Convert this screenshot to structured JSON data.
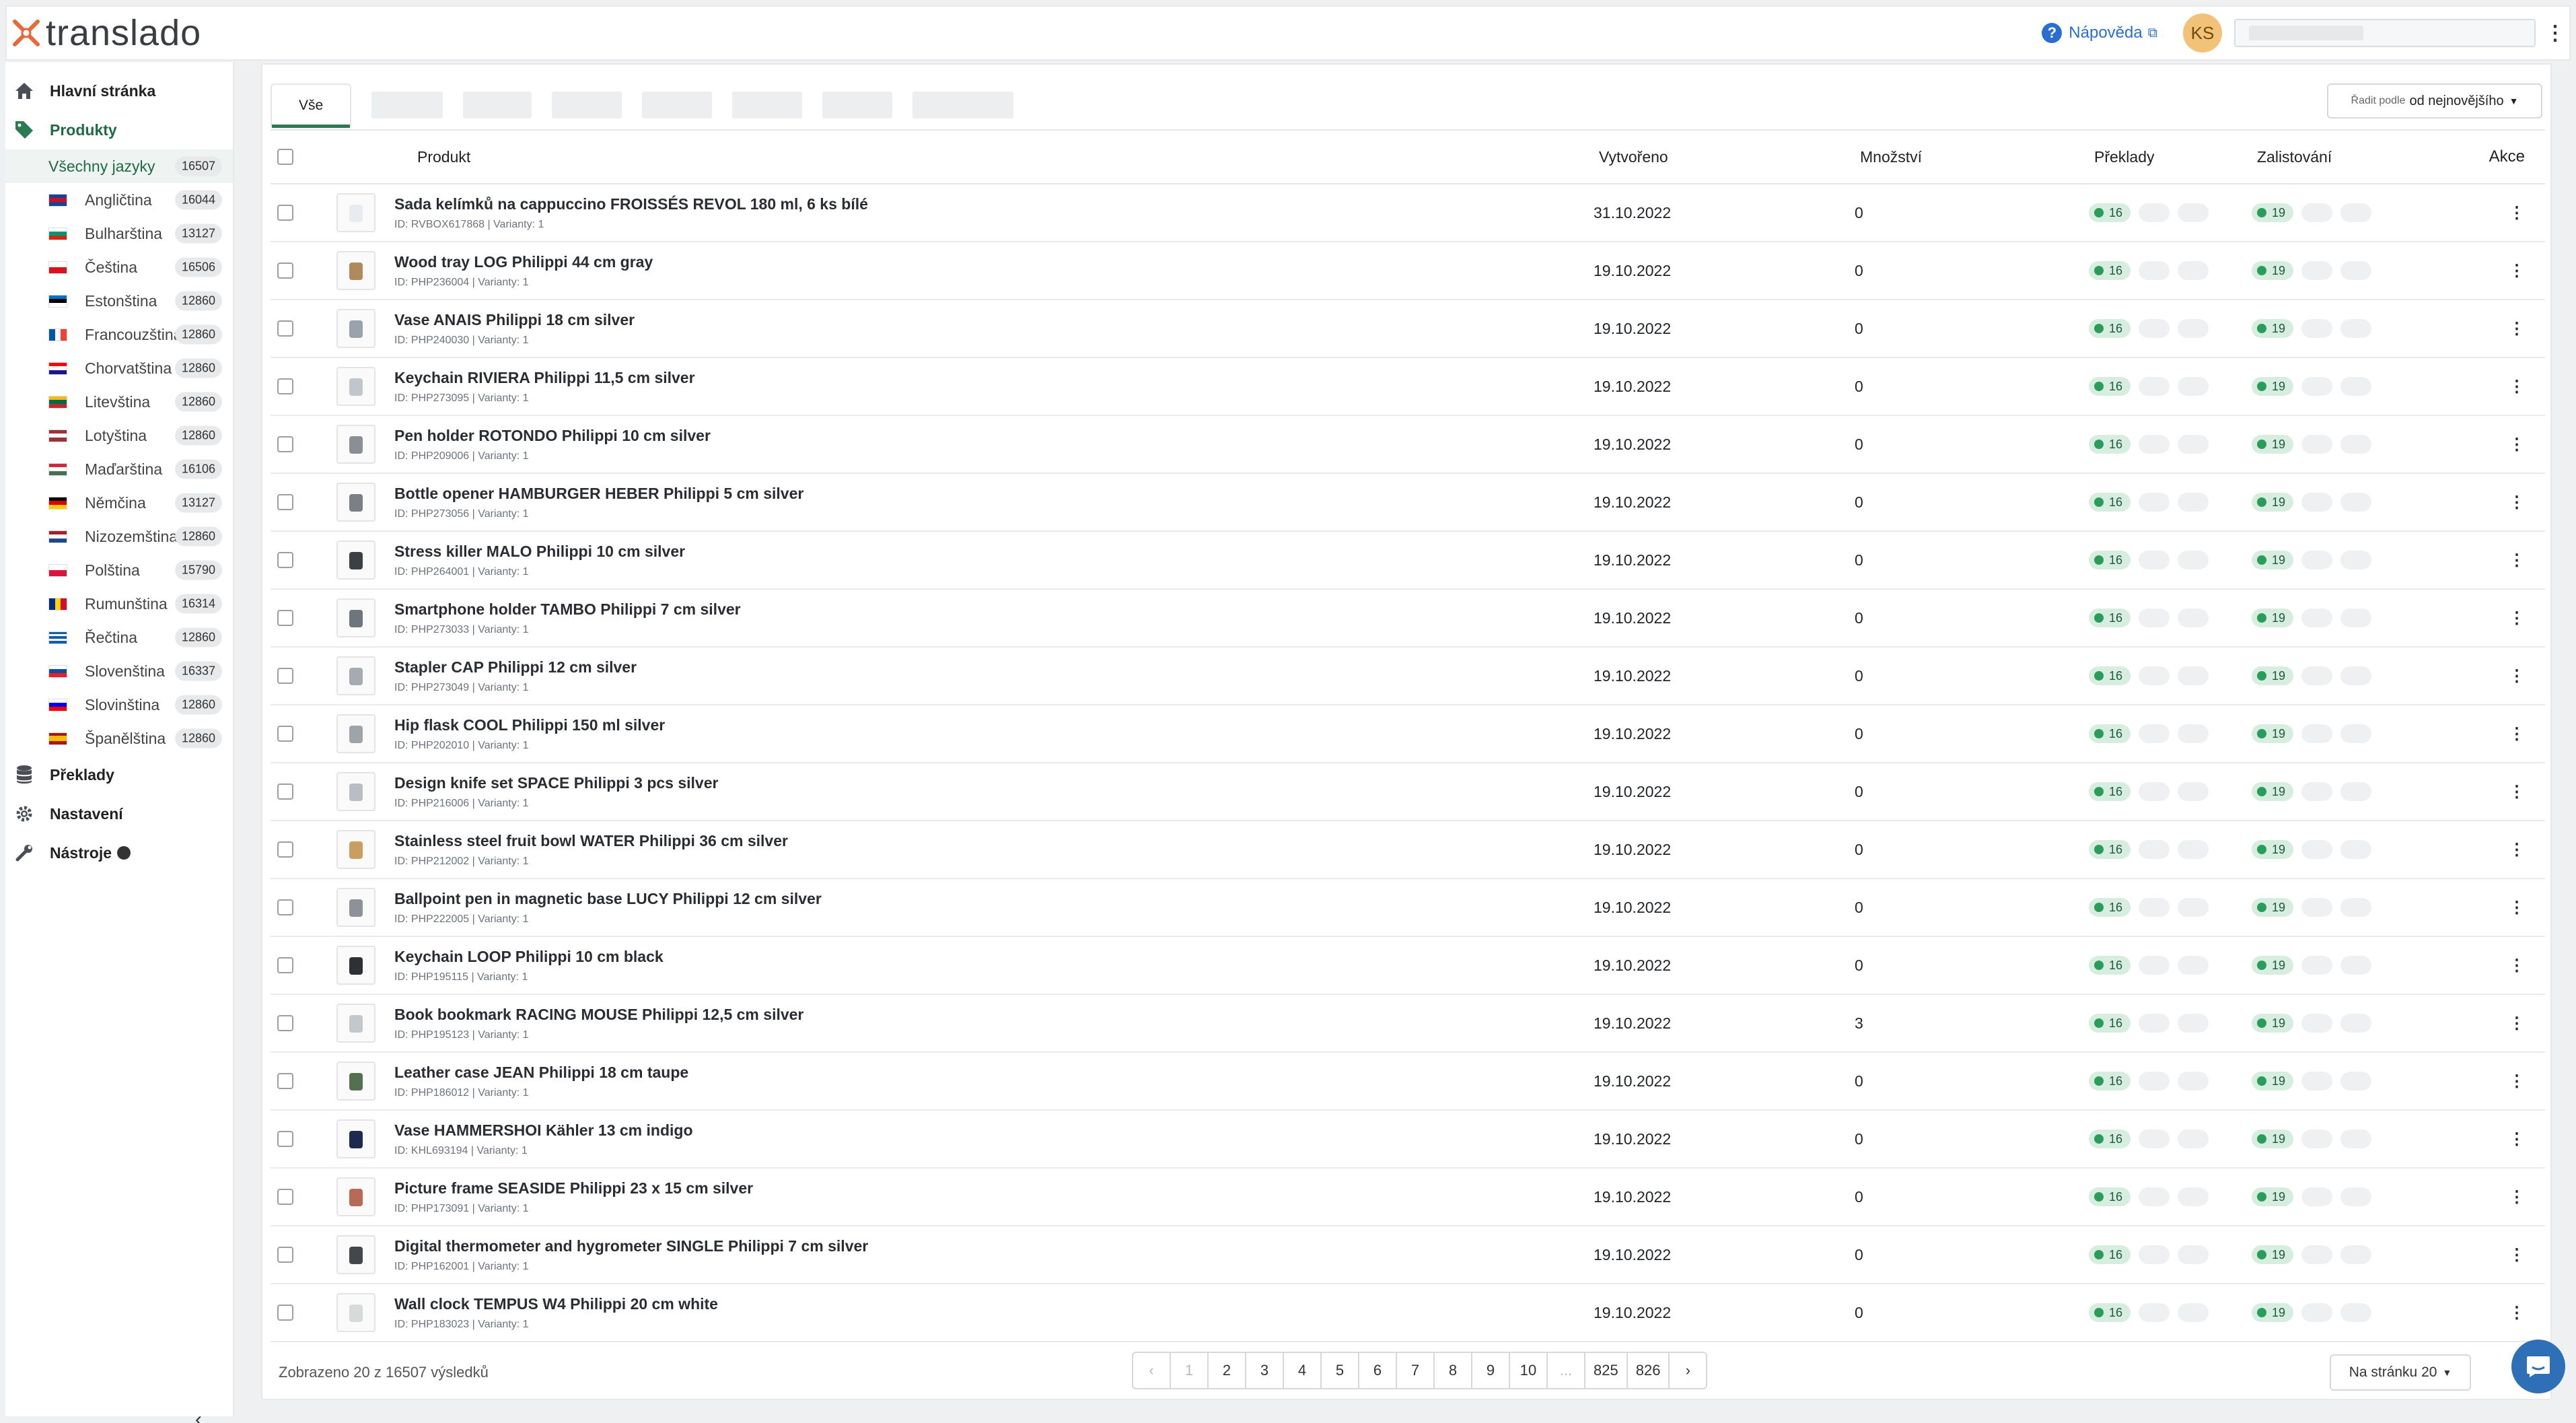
{
  "app": {
    "logo_text": "translado"
  },
  "header": {
    "help_label": "Nápověda",
    "avatar_initials": "KS"
  },
  "sidebar": {
    "home": "Hlavní stránka",
    "products": "Produkty",
    "all_languages": {
      "label": "Všechny jazyky",
      "count": "16507"
    },
    "languages": [
      {
        "label": "Angličtina",
        "count": "16044",
        "flag": "gb"
      },
      {
        "label": "Bulharština",
        "count": "13127",
        "flag": "bg"
      },
      {
        "label": "Čeština",
        "count": "16506",
        "flag": "cz"
      },
      {
        "label": "Estonština",
        "count": "12860",
        "flag": "ee"
      },
      {
        "label": "Francouzština",
        "count": "12860",
        "flag": "fr"
      },
      {
        "label": "Chorvatština",
        "count": "12860",
        "flag": "hr"
      },
      {
        "label": "Litevština",
        "count": "12860",
        "flag": "lt"
      },
      {
        "label": "Lotyština",
        "count": "12860",
        "flag": "lv"
      },
      {
        "label": "Maďarština",
        "count": "16106",
        "flag": "hu"
      },
      {
        "label": "Němčina",
        "count": "13127",
        "flag": "de"
      },
      {
        "label": "Nizozemština",
        "count": "12860",
        "flag": "nl"
      },
      {
        "label": "Polština",
        "count": "15790",
        "flag": "pl"
      },
      {
        "label": "Rumunština",
        "count": "16314",
        "flag": "ro"
      },
      {
        "label": "Řečtina",
        "count": "12860",
        "flag": "gr"
      },
      {
        "label": "Slovenština",
        "count": "16337",
        "flag": "sk"
      },
      {
        "label": "Slovinština",
        "count": "12860",
        "flag": "si"
      },
      {
        "label": "Španělština",
        "count": "12860",
        "flag": "es"
      }
    ],
    "translations": "Překlady",
    "settings": "Nastavení",
    "tools": "Nástroje"
  },
  "tabs": {
    "all": "Vše"
  },
  "sort": {
    "prefix": "Řadit podle",
    "value": "od nejnovějšího"
  },
  "table": {
    "headers": {
      "product": "Produkt",
      "created": "Vytvořeno",
      "quantity": "Množství",
      "translations": "Překlady",
      "listings": "Zalistování",
      "actions": "Akce"
    },
    "rows": [
      {
        "name": "Sada kelímků na cappuccino FROISSÉS REVOL 180 ml, 6 ks bílé",
        "meta": "ID: RVBOX617868 | Varianty: 1",
        "date": "31.10.2022",
        "qty": "0",
        "tr": "16",
        "ls": "19"
      },
      {
        "name": "Wood tray LOG Philippi 44 cm gray",
        "meta": "ID: PHP236004 | Varianty: 1",
        "date": "19.10.2022",
        "qty": "0",
        "tr": "16",
        "ls": "19"
      },
      {
        "name": "Vase ANAIS Philippi 18 cm silver",
        "meta": "ID: PHP240030 | Varianty: 1",
        "date": "19.10.2022",
        "qty": "0",
        "tr": "16",
        "ls": "19"
      },
      {
        "name": "Keychain RIVIERA Philippi 11,5 cm silver",
        "meta": "ID: PHP273095 | Varianty: 1",
        "date": "19.10.2022",
        "qty": "0",
        "tr": "16",
        "ls": "19"
      },
      {
        "name": "Pen holder ROTONDO Philippi 10 cm silver",
        "meta": "ID: PHP209006 | Varianty: 1",
        "date": "19.10.2022",
        "qty": "0",
        "tr": "16",
        "ls": "19"
      },
      {
        "name": "Bottle opener HAMBURGER HEBER Philippi 5 cm silver",
        "meta": "ID: PHP273056 | Varianty: 1",
        "date": "19.10.2022",
        "qty": "0",
        "tr": "16",
        "ls": "19"
      },
      {
        "name": "Stress killer MALO Philippi 10 cm silver",
        "meta": "ID: PHP264001 | Varianty: 1",
        "date": "19.10.2022",
        "qty": "0",
        "tr": "16",
        "ls": "19"
      },
      {
        "name": "Smartphone holder TAMBO Philippi 7 cm silver",
        "meta": "ID: PHP273033 | Varianty: 1",
        "date": "19.10.2022",
        "qty": "0",
        "tr": "16",
        "ls": "19"
      },
      {
        "name": "Stapler CAP Philippi 12 cm silver",
        "meta": "ID: PHP273049 | Varianty: 1",
        "date": "19.10.2022",
        "qty": "0",
        "tr": "16",
        "ls": "19"
      },
      {
        "name": "Hip flask COOL Philippi 150 ml silver",
        "meta": "ID: PHP202010 | Varianty: 1",
        "date": "19.10.2022",
        "qty": "0",
        "tr": "16",
        "ls": "19"
      },
      {
        "name": "Design knife set SPACE Philippi 3 pcs silver",
        "meta": "ID: PHP216006 | Varianty: 1",
        "date": "19.10.2022",
        "qty": "0",
        "tr": "16",
        "ls": "19"
      },
      {
        "name": "Stainless steel fruit bowl WATER Philippi 36 cm silver",
        "meta": "ID: PHP212002 | Varianty: 1",
        "date": "19.10.2022",
        "qty": "0",
        "tr": "16",
        "ls": "19"
      },
      {
        "name": "Ballpoint pen in magnetic base LUCY Philippi 12 cm silver",
        "meta": "ID: PHP222005 | Varianty: 1",
        "date": "19.10.2022",
        "qty": "0",
        "tr": "16",
        "ls": "19"
      },
      {
        "name": "Keychain LOOP Philippi 10 cm black",
        "meta": "ID: PHP195115 | Varianty: 1",
        "date": "19.10.2022",
        "qty": "0",
        "tr": "16",
        "ls": "19"
      },
      {
        "name": "Book bookmark RACING MOUSE Philippi 12,5 cm silver",
        "meta": "ID: PHP195123 | Varianty: 1",
        "date": "19.10.2022",
        "qty": "3",
        "tr": "16",
        "ls": "19"
      },
      {
        "name": "Leather case JEAN Philippi 18 cm taupe",
        "meta": "ID: PHP186012 | Varianty: 1",
        "date": "19.10.2022",
        "qty": "0",
        "tr": "16",
        "ls": "19"
      },
      {
        "name": "Vase HAMMERSHOI Kähler 13 cm indigo",
        "meta": "ID: KHL693194 | Varianty: 1",
        "date": "19.10.2022",
        "qty": "0",
        "tr": "16",
        "ls": "19"
      },
      {
        "name": "Picture frame SEASIDE Philippi 23 x 15 cm silver",
        "meta": "ID: PHP173091 | Varianty: 1",
        "date": "19.10.2022",
        "qty": "0",
        "tr": "16",
        "ls": "19"
      },
      {
        "name": "Digital thermometer and hygrometer SINGLE Philippi 7 cm silver",
        "meta": "ID: PHP162001 | Varianty: 1",
        "date": "19.10.2022",
        "qty": "0",
        "tr": "16",
        "ls": "19"
      },
      {
        "name": "Wall clock TEMPUS W4 Philippi 20 cm white",
        "meta": "ID: PHP183023 | Varianty: 1",
        "date": "19.10.2022",
        "qty": "0",
        "tr": "16",
        "ls": "19"
      }
    ]
  },
  "footer": {
    "showing": "Zobrazeno 20 z 16507 výsledků",
    "pages": [
      "‹",
      "1",
      "2",
      "3",
      "4",
      "5",
      "6",
      "7",
      "8",
      "9",
      "10",
      "...",
      "825",
      "826",
      "›"
    ],
    "per_page_label": "Na stránku 20"
  },
  "colors": {
    "accent": "#1f6b45",
    "pill_green": "#d6ede0",
    "link_blue": "#2a6fcf"
  }
}
